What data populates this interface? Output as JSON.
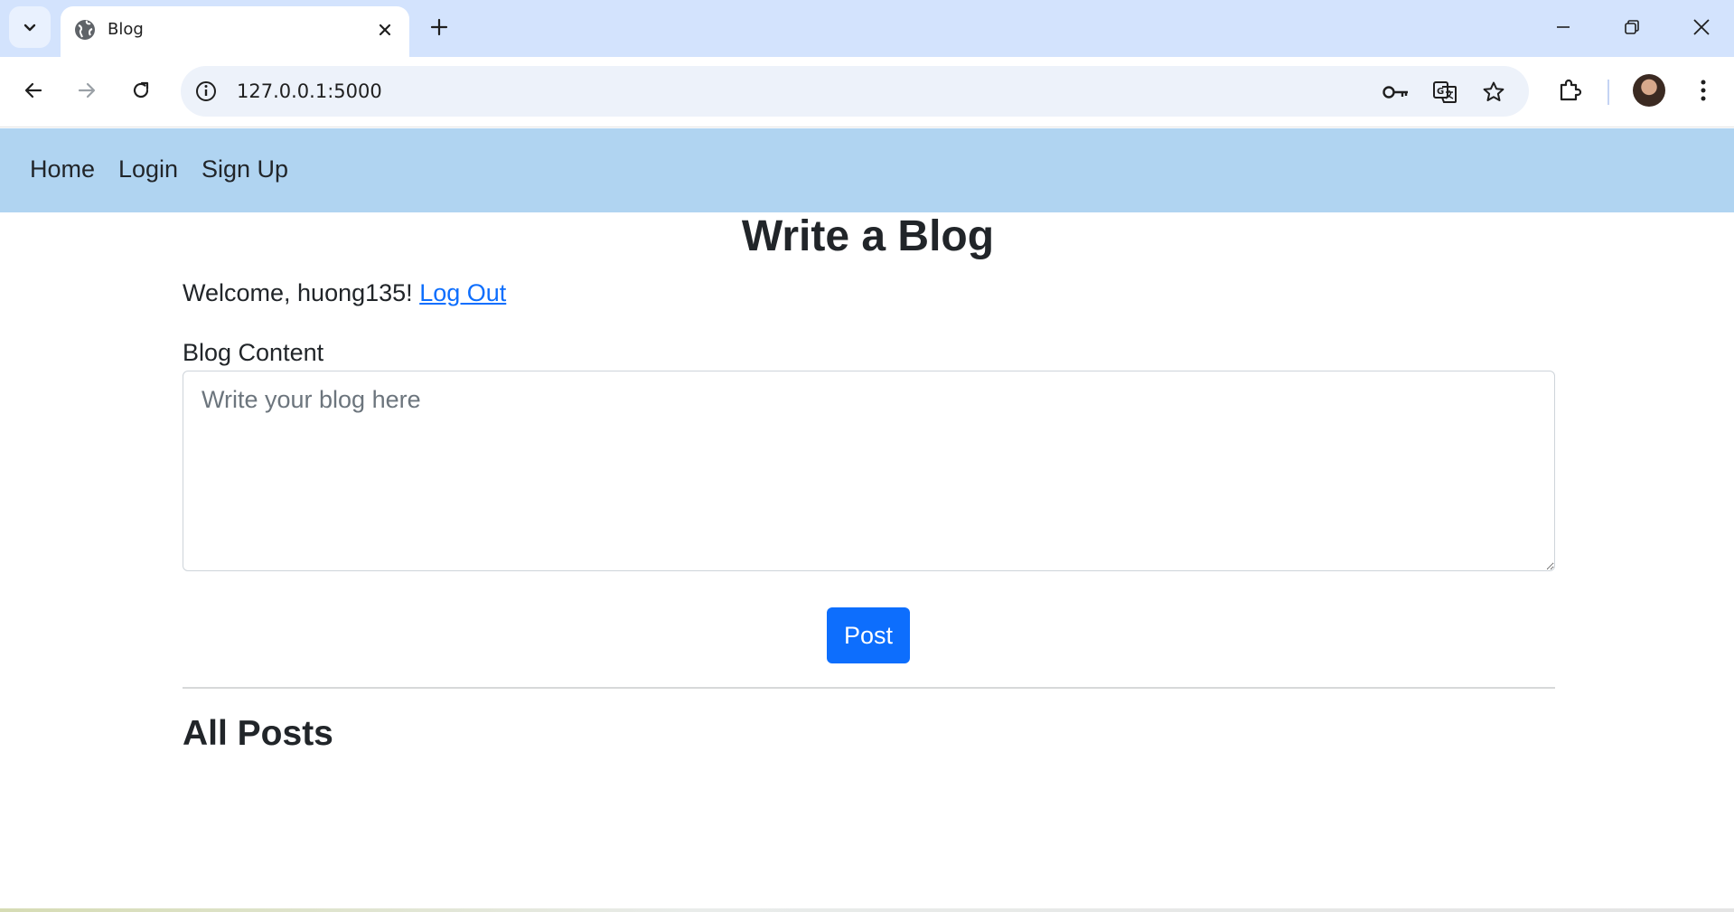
{
  "browser": {
    "tab_title": "Blog",
    "url": "127.0.0.1:5000",
    "colors": {
      "tabstrip": "#d3e3fd",
      "omnibox": "#edf2fa"
    }
  },
  "nav": {
    "links": [
      {
        "label": "Home"
      },
      {
        "label": "Login"
      },
      {
        "label": "Sign Up"
      }
    ],
    "background": "#b0d4f1"
  },
  "page": {
    "title": "Write a Blog",
    "welcome_prefix": "Welcome, huong135!",
    "logout_label": "Log Out",
    "content_label": "Blog Content",
    "content_placeholder": "Write your blog here",
    "post_button": "Post",
    "all_posts_title": "All Posts",
    "accent": "#0d6efd"
  }
}
